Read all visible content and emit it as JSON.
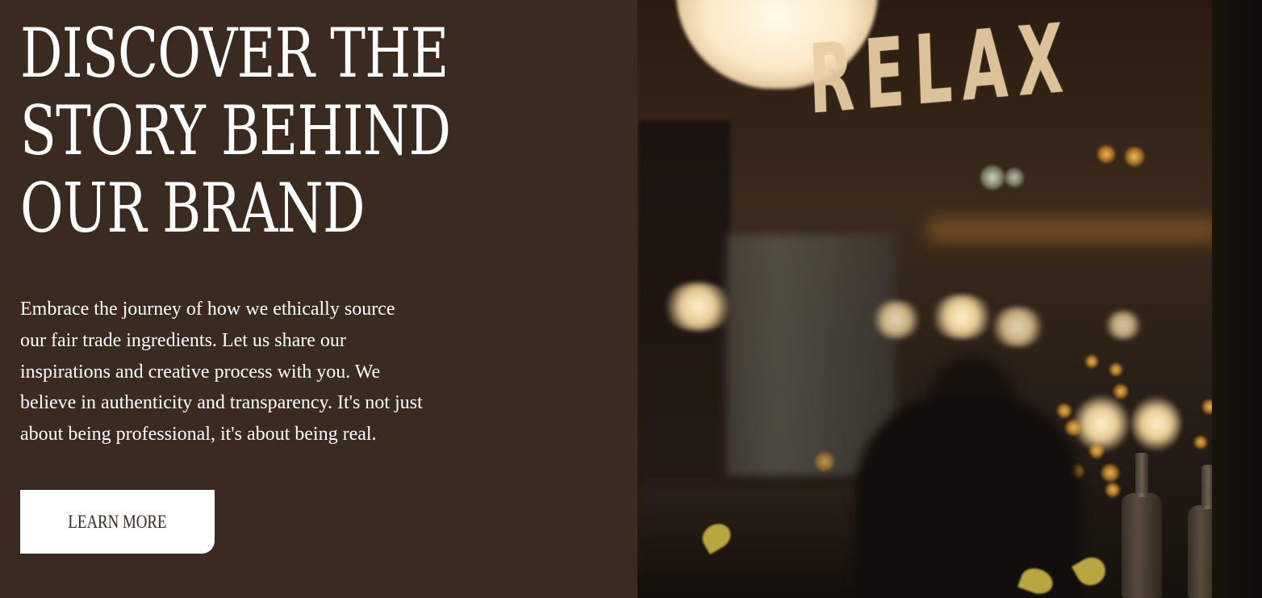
{
  "hero": {
    "title_lines": [
      "DISCOVER THE",
      "STORY BEHIND",
      "OUR BRAND"
    ],
    "description": "Embrace the journey of how we ethically source our fair trade ingredients. Let us share our inspirations and creative process with you. We believe in authenticity and transparency. It's not just about being professional, it's about being real.",
    "button_label": "LEARN MORE"
  },
  "photo": {
    "sign_text": "RELAX",
    "icon": "cafe-interior-photo"
  },
  "colors": {
    "background": "#3a2a1f",
    "text": "#ffffff",
    "button_bg": "#ffffff",
    "button_text": "#3a2a1f",
    "sign": "#e9cfa2"
  }
}
